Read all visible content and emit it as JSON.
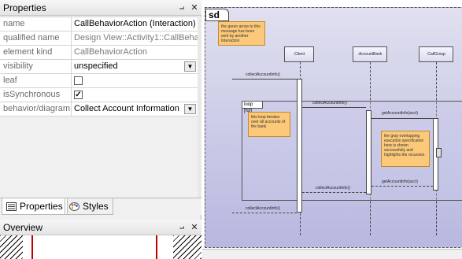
{
  "properties_panel": {
    "title": "Properties",
    "pin_icon": "pin-icon",
    "close_icon": "close-icon",
    "rows": [
      {
        "name": "name",
        "value": "CallBehaviorAction (Interaction)",
        "style": "black"
      },
      {
        "name": "qualified name",
        "value": "Design View::Activity1::CallBeha",
        "style": "gray"
      },
      {
        "name": "element kind",
        "value": "CallBehaviorAction",
        "style": "gray"
      },
      {
        "name": "visibility",
        "value": "unspecified",
        "style": "black",
        "dropdown": true
      },
      {
        "name": "leaf",
        "value": "",
        "checkbox": false
      },
      {
        "name": "isSynchronous",
        "value": "",
        "checkbox": true
      },
      {
        "name": "behavior/diagram",
        "value": "Collect Account Information",
        "style": "black",
        "dropdown": true
      }
    ]
  },
  "tabs": [
    {
      "label": "Properties",
      "icon": "properties-icon"
    },
    {
      "label": "Styles",
      "icon": "styles-palette-icon"
    }
  ],
  "overview_panel": {
    "title": "Overview"
  },
  "diagram": {
    "frame_label": "sd",
    "note_top": "the green arrow to this message has been sent by another Interaction",
    "note_loop": "this loop iterates over all accounts of the bank",
    "note_right": "the gray overlapping execution specification here is shown successfully and highlights the recursion",
    "loop_label": "loop [for]",
    "lifelines": [
      ":Client",
      ":AccountBank",
      ":CallGroup"
    ],
    "messages": [
      "collectAccountInfo()",
      "collectAccountInfo()",
      "getAccountInfo(acct)",
      "getAccountInfo(acct)",
      "collectAccountInfo()",
      "collectAccountInfo()"
    ]
  },
  "colors": {
    "note": "#fcc97a",
    "frame_bg_top": "#e0e0f0",
    "frame_bg_bottom": "#b8b8e0",
    "overview_frame": "#c00000"
  }
}
